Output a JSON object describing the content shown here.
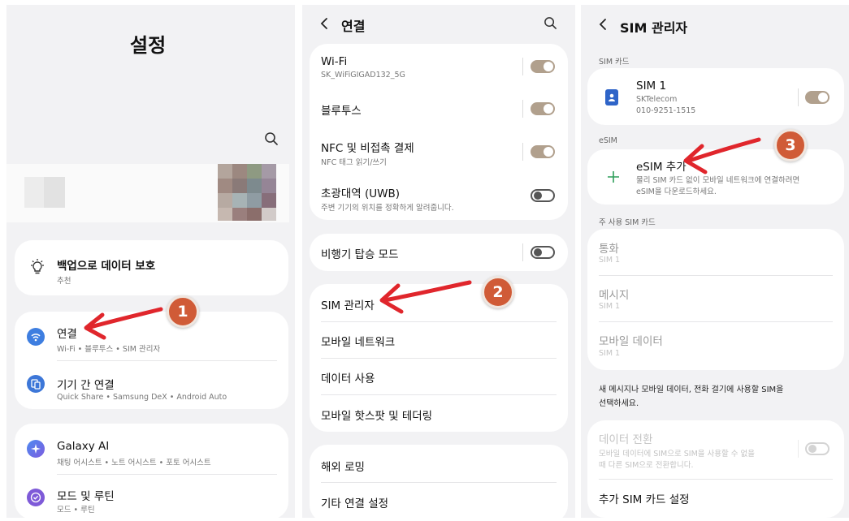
{
  "colors": {
    "accent": "#d05b37",
    "toggle_on": "#b1a08d",
    "panel_bg": "#f2f2f4",
    "arrow": "#e0262c"
  },
  "panel1": {
    "title": "설정",
    "backup": {
      "title": "백업으로 데이터 보호",
      "sub": "추천",
      "icon": "lightbulb-icon"
    },
    "connections": {
      "title": "연결",
      "sub": "Wi-Fi • 블루투스 • SIM 관리자",
      "icon": "wifi-icon"
    },
    "device_connect": {
      "title": "기기 간 연결",
      "sub": "Quick Share • Samsung DeX • Android Auto",
      "icon": "devices-icon"
    },
    "galaxy_ai": {
      "title": "Galaxy AI",
      "sub": "채팅 어시스트 • 노트 어시스트 • 포토 어시스트",
      "icon": "sparkle-icon"
    },
    "modes": {
      "title": "모드 및 루틴",
      "sub": "모드 • 루틴",
      "icon": "check-circle-icon"
    },
    "badge": "1"
  },
  "panel2": {
    "title": "연결",
    "wifi": {
      "title": "Wi-Fi",
      "sub": "SK_WiFiGIGAD132_5G"
    },
    "bluetooth": {
      "title": "블루투스"
    },
    "nfc": {
      "title": "NFC 및 비접촉 결제",
      "sub": "NFC 태그 읽기/쓰기"
    },
    "uwb": {
      "title": "초광대역 (UWB)",
      "sub": "주변 기기의 위치를 정확하게 알려줍니다."
    },
    "airplane": {
      "title": "비행기 탑승 모드"
    },
    "sim_manager": {
      "title": "SIM 관리자"
    },
    "mobile_network": {
      "title": "모바일 네트워크"
    },
    "data_usage": {
      "title": "데이터 사용"
    },
    "hotspot": {
      "title": "모바일 핫스팟 및 테더링"
    },
    "roaming": {
      "title": "해외 로밍"
    },
    "more": {
      "title": "기타 연결 설정"
    },
    "badge": "2"
  },
  "panel3": {
    "title": "SIM 관리자",
    "sim_section": "SIM 카드",
    "sim1": {
      "title": "SIM 1",
      "carrier": "SKTelecom",
      "number": "010-9251-1515"
    },
    "esim_section": "eSIM",
    "esim_add": {
      "title": "eSIM 추가",
      "sub1": "물리 SIM 카드 없이 모바일 네트워크에 연결하려면",
      "sub2": "eSIM을 다운로드하세요."
    },
    "primary_section": "주 사용 SIM 카드",
    "calls": {
      "title": "통화",
      "sub": "SIM 1"
    },
    "messages": {
      "title": "메시지",
      "sub": "SIM 1"
    },
    "mobile_data": {
      "title": "모바일 데이터",
      "sub": "SIM 1"
    },
    "note1": "새 메시지나 모바일 데이터, 전화 걸기에 사용할 SIM을",
    "note2": "선택하세요.",
    "data_switch": {
      "title": "데이터 전환",
      "sub1": "모바일 데이터에 SIM으로 SIM을 사용할 수 없을",
      "sub2": "때 다른 SIM으로 전환합니다."
    },
    "extra_sim": {
      "title": "추가 SIM 카드 설정"
    },
    "badge": "3"
  }
}
